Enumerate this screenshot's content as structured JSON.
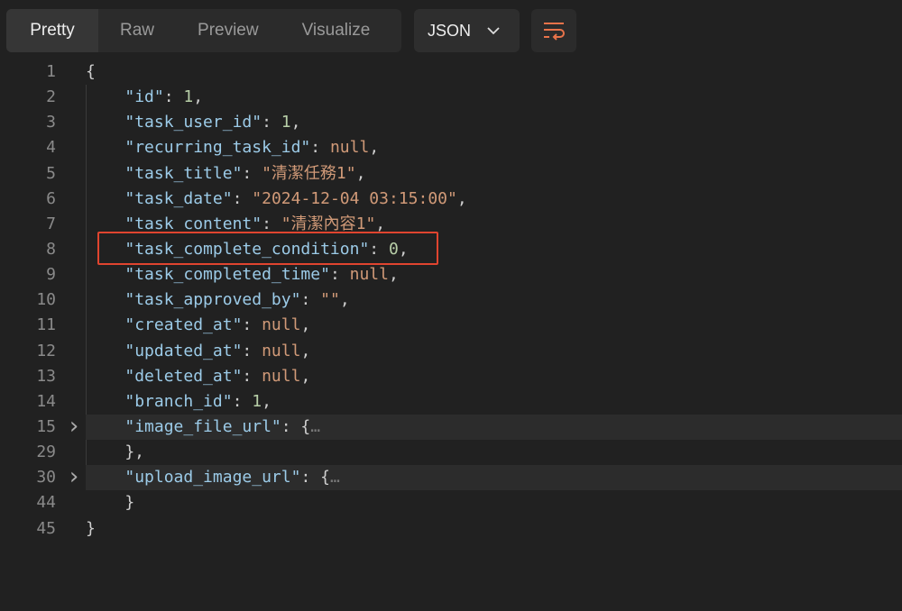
{
  "tabs": [
    "Pretty",
    "Raw",
    "Preview",
    "Visualize"
  ],
  "format": "JSON",
  "lines": [
    {
      "n": "1",
      "t": [
        [
          "p",
          "{"
        ]
      ]
    },
    {
      "n": "2",
      "t": [
        [
          "p",
          "    "
        ],
        [
          "k",
          "\"id\""
        ],
        [
          "p",
          ": "
        ],
        [
          "n",
          "1"
        ],
        [
          "p",
          ","
        ]
      ]
    },
    {
      "n": "3",
      "t": [
        [
          "p",
          "    "
        ],
        [
          "k",
          "\"task_user_id\""
        ],
        [
          "p",
          ": "
        ],
        [
          "n",
          "1"
        ],
        [
          "p",
          ","
        ]
      ]
    },
    {
      "n": "4",
      "t": [
        [
          "p",
          "    "
        ],
        [
          "k",
          "\"recurring_task_id\""
        ],
        [
          "p",
          ": "
        ],
        [
          "s",
          "null"
        ],
        [
          "p",
          ","
        ]
      ]
    },
    {
      "n": "5",
      "t": [
        [
          "p",
          "    "
        ],
        [
          "k",
          "\"task_title\""
        ],
        [
          "p",
          ": "
        ],
        [
          "s",
          "\"清潔任務1\""
        ],
        [
          "p",
          ","
        ]
      ]
    },
    {
      "n": "6",
      "t": [
        [
          "p",
          "    "
        ],
        [
          "k",
          "\"task_date\""
        ],
        [
          "p",
          ": "
        ],
        [
          "s",
          "\"2024-12-04 03:15:00\""
        ],
        [
          "p",
          ","
        ]
      ]
    },
    {
      "n": "7",
      "t": [
        [
          "p",
          "    "
        ],
        [
          "k",
          "\"task_content\""
        ],
        [
          "p",
          ": "
        ],
        [
          "s",
          "\"清潔內容1\""
        ],
        [
          "p",
          ","
        ]
      ]
    },
    {
      "n": "8",
      "t": [
        [
          "p",
          "    "
        ],
        [
          "k",
          "\"task_complete_condition\""
        ],
        [
          "p",
          ": "
        ],
        [
          "n",
          "0"
        ],
        [
          "p",
          ","
        ]
      ]
    },
    {
      "n": "9",
      "t": [
        [
          "p",
          "    "
        ],
        [
          "k",
          "\"task_completed_time\""
        ],
        [
          "p",
          ": "
        ],
        [
          "s",
          "null"
        ],
        [
          "p",
          ","
        ]
      ]
    },
    {
      "n": "10",
      "t": [
        [
          "p",
          "    "
        ],
        [
          "k",
          "\"task_approved_by\""
        ],
        [
          "p",
          ": "
        ],
        [
          "s",
          "\"\""
        ],
        [
          "p",
          ","
        ]
      ]
    },
    {
      "n": "11",
      "t": [
        [
          "p",
          "    "
        ],
        [
          "k",
          "\"created_at\""
        ],
        [
          "p",
          ": "
        ],
        [
          "s",
          "null"
        ],
        [
          "p",
          ","
        ]
      ]
    },
    {
      "n": "12",
      "t": [
        [
          "p",
          "    "
        ],
        [
          "k",
          "\"updated_at\""
        ],
        [
          "p",
          ": "
        ],
        [
          "s",
          "null"
        ],
        [
          "p",
          ","
        ]
      ]
    },
    {
      "n": "13",
      "t": [
        [
          "p",
          "    "
        ],
        [
          "k",
          "\"deleted_at\""
        ],
        [
          "p",
          ": "
        ],
        [
          "s",
          "null"
        ],
        [
          "p",
          ","
        ]
      ]
    },
    {
      "n": "14",
      "t": [
        [
          "p",
          "    "
        ],
        [
          "k",
          "\"branch_id\""
        ],
        [
          "p",
          ": "
        ],
        [
          "n",
          "1"
        ],
        [
          "p",
          ","
        ]
      ]
    },
    {
      "n": "15",
      "fold": true,
      "t": [
        [
          "p",
          "    "
        ],
        [
          "k",
          "\"image_file_url\""
        ],
        [
          "p",
          ": {"
        ],
        [
          "e",
          "…"
        ]
      ]
    },
    {
      "n": "29",
      "t": [
        [
          "p",
          "    },"
        ]
      ]
    },
    {
      "n": "30",
      "fold": true,
      "t": [
        [
          "p",
          "    "
        ],
        [
          "k",
          "\"upload_image_url\""
        ],
        [
          "p",
          ": {"
        ],
        [
          "e",
          "…"
        ]
      ]
    },
    {
      "n": "44",
      "t": [
        [
          "p",
          "    }"
        ]
      ]
    },
    {
      "n": "45",
      "t": [
        [
          "p",
          "}"
        ]
      ]
    }
  ]
}
